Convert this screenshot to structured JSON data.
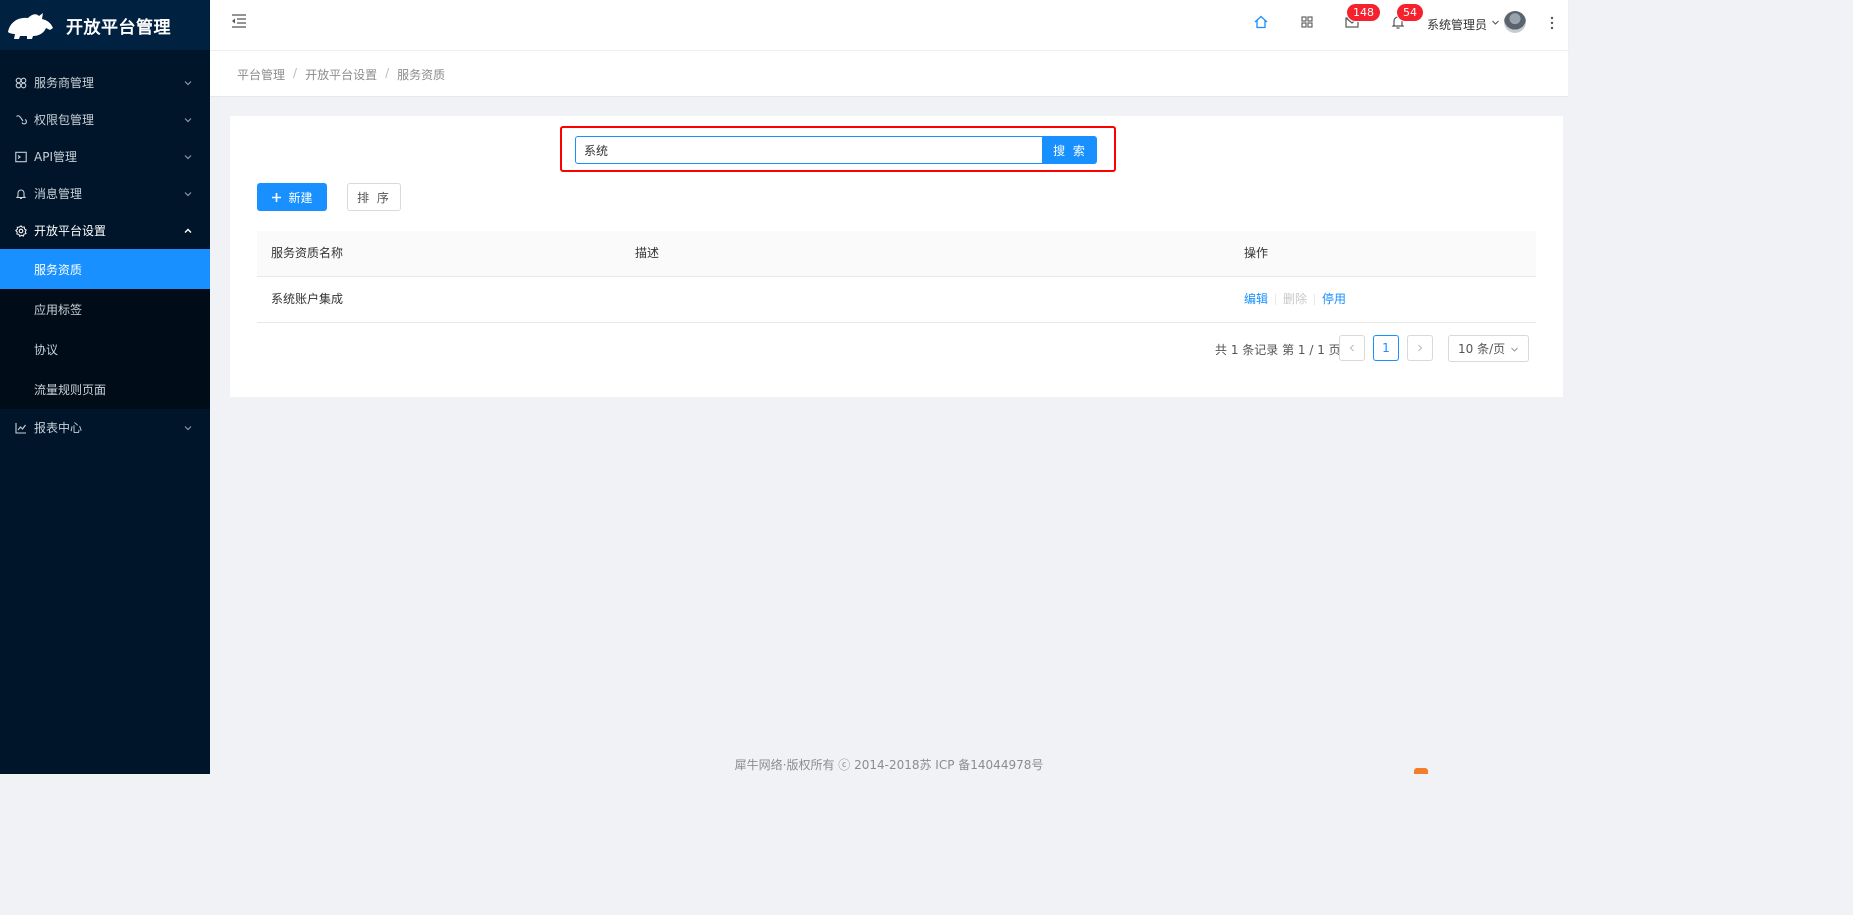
{
  "brand": {
    "title": "开放平台管理"
  },
  "sidebar": {
    "items": [
      {
        "label": "服务商管理",
        "icon": "cluster-icon"
      },
      {
        "label": "权限包管理",
        "icon": "link-icon"
      },
      {
        "label": "API管理",
        "icon": "terminal-icon"
      },
      {
        "label": "消息管理",
        "icon": "bell-icon"
      },
      {
        "label": "开放平台设置",
        "icon": "gear-icon",
        "open": true,
        "children": [
          "服务资质",
          "应用标签",
          "协议",
          "流量规则页面"
        ]
      },
      {
        "label": "报表中心",
        "icon": "line-chart-icon"
      }
    ]
  },
  "header": {
    "mail_badge": "148",
    "bell_badge": "54",
    "user_name": "系统管理员"
  },
  "breadcrumb": [
    "平台管理",
    "开放平台设置",
    "服务资质"
  ],
  "search": {
    "value": "系统",
    "button_label": "搜 索"
  },
  "toolbar": {
    "new_label": "新建",
    "sort_label": "排 序"
  },
  "table": {
    "columns": [
      "服务资质名称",
      "描述",
      "操作"
    ],
    "rows": [
      {
        "name": "系统账户集成",
        "description": "",
        "actions": [
          "编辑",
          "删除",
          "停用"
        ]
      }
    ]
  },
  "pagination": {
    "total_text": "共 1 条记录 第 1 / 1 页",
    "current_page": "1",
    "page_size": "10 条/页"
  },
  "footer": {
    "copyright": "犀牛网络·版权所有 ⓒ 2014-2018苏 ICP 备14044978号"
  },
  "colors": {
    "accent": "#1890ff",
    "sidebar_bg": "#001529",
    "badge": "#f5222d",
    "highlight_box": "#ff0000"
  }
}
